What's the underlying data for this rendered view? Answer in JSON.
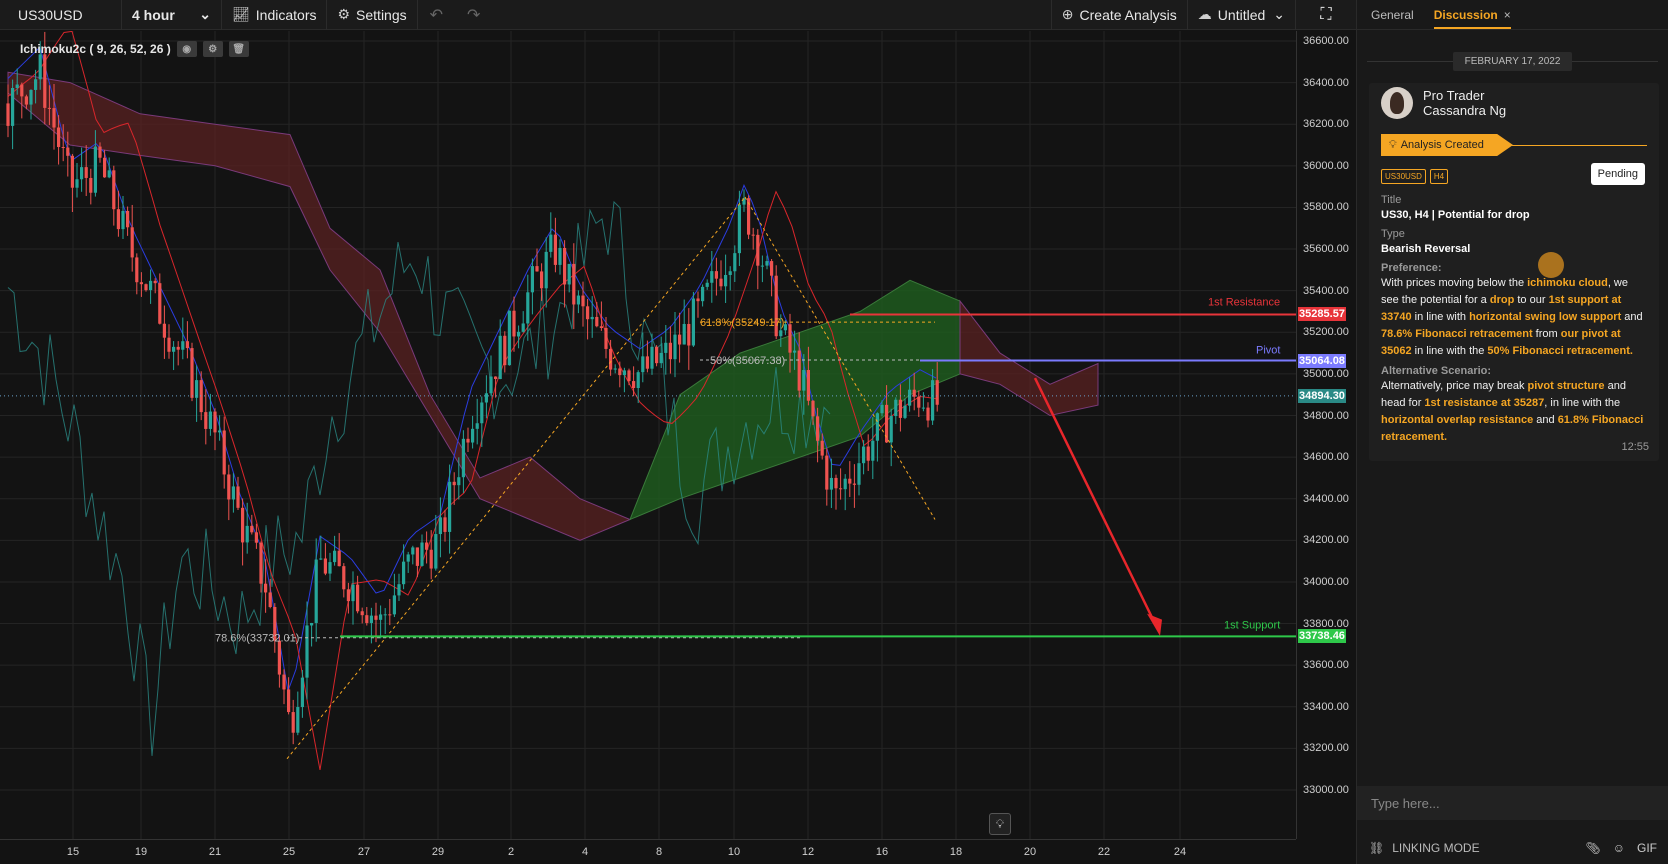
{
  "toolbar": {
    "symbol": "US30USD",
    "interval": "4 hour",
    "indicators_label": "Indicators",
    "settings_label": "Settings",
    "create_analysis_label": "Create Analysis",
    "layout_label": "Untitled"
  },
  "chart": {
    "indicator_legend": "Ichimoku2c ( 9, 26, 52, 26 )",
    "annotations": {
      "resistance_label": "1st Resistance",
      "pivot_label": "Pivot",
      "support_label": "1st Support",
      "fib_618": "61.8%(35249.17)",
      "fib_50": "50%(35067.38)",
      "fib_786": "78.6%(33732.01)"
    },
    "price_tags": {
      "resistance": "35285.57",
      "pivot": "35064.08",
      "current": "34894.30",
      "support": "33738.46"
    },
    "colors": {
      "bull": "#26a69a",
      "bear": "#ef5350",
      "resistance": "#e8343a",
      "pivot": "#7b7bff",
      "support": "#2ec84a",
      "kumo_bull": "#1f5a1f",
      "kumo_bear": "#5a2222"
    }
  },
  "chart_data": {
    "type": "candlestick",
    "symbol": "US30USD",
    "interval": "4 hour",
    "y_ticks": [
      36600,
      36400,
      36200,
      36000,
      35800,
      35600,
      35400,
      35200,
      35000,
      34800,
      34600,
      34400,
      34200,
      34000,
      33800,
      33600,
      33400,
      33200,
      33000
    ],
    "ylim": [
      33000,
      36600
    ],
    "x_ticks": [
      "15",
      "19",
      "21",
      "25",
      "27",
      "29",
      "2",
      "4",
      "8",
      "10",
      "12",
      "16",
      "18",
      "20",
      "22",
      "24"
    ],
    "levels": [
      {
        "name": "1st Resistance",
        "value": 35285.57
      },
      {
        "name": "Pivot",
        "value": 35064.08
      },
      {
        "name": "1st Support",
        "value": 33738.46
      }
    ],
    "fibonacci": [
      {
        "label": "61.8%(35249.17)",
        "value": 35249.17
      },
      {
        "label": "50%(35067.38)",
        "value": 35067.38
      },
      {
        "label": "78.6%(33732.01)",
        "value": 33732.01
      }
    ],
    "current_price": 34894.3,
    "grid": true
  },
  "panel": {
    "tab_general": "General",
    "tab_discussion": "Discussion",
    "tab_close": "×",
    "date": "FEBRUARY 17, 2022",
    "author_line1": "Pro Trader",
    "author_line2": "Cassandra Ng",
    "status": "Analysis Created",
    "tag_symbol": "US30USD",
    "tag_interval": "H4",
    "pending": "Pending",
    "title_label": "Title",
    "title_value": "US30, H4 | Potential for drop",
    "type_label": "Type",
    "type_value": "Bearish Reversal",
    "preference_label": "Preference:",
    "pref": {
      "t1": "With prices moving below the ",
      "h1": "ichimoku cloud",
      "t2": ", we see the potential for a ",
      "h2": "drop",
      "t3": " to our ",
      "h3": "1st support at 33740",
      "t4": " in line with ",
      "h4": "horizontal swing low support",
      "t5": " and ",
      "h5": "78.6% Fibonacci retracement",
      "t6": " from ",
      "h6": "our pivot at 35062",
      "t7": " in line with the ",
      "h7": "50% Fibonacci retracement."
    },
    "alt_label": "Alternative Scenario:",
    "alt": {
      "t1": "Alternatively, price may break ",
      "h1": "pivot structure",
      "t2": " and head for ",
      "h2": "1st resistance at 35287",
      "t3": ", in line with the ",
      "h3": "horizontal overlap resistance",
      "t4": " and ",
      "h4": "61.8% Fibonacci retracement."
    },
    "time": "12:55",
    "input_placeholder": "Type here...",
    "linking_mode": "LINKING MODE",
    "gif_label": "GIF"
  }
}
